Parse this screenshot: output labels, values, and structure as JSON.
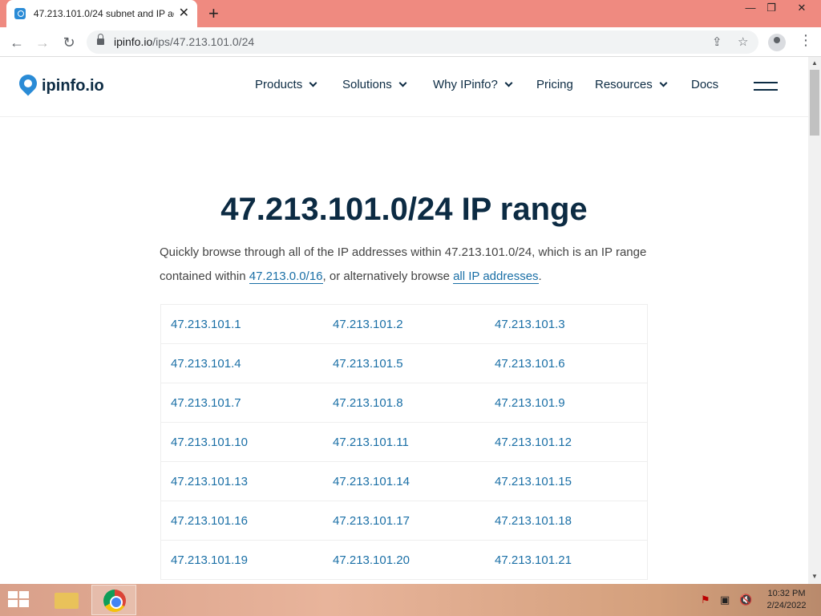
{
  "browser": {
    "tab_title": "47.213.101.0/24 subnet and IP ad",
    "url_host": "ipinfo.io",
    "url_path": "/ips/47.213.101.0/24"
  },
  "site": {
    "logo_text": "ipinfo.io",
    "nav": {
      "products": "Products",
      "solutions": "Solutions",
      "why": "Why IPinfo?",
      "pricing": "Pricing",
      "resources": "Resources",
      "docs": "Docs"
    }
  },
  "main": {
    "title": "47.213.101.0/24 IP range",
    "intro_1": "Quickly browse through all of the IP addresses within 47.213.101.0/24, which is an IP range contained within ",
    "parent_range_link": "47.213.0.0/16",
    "intro_2": ", or alternatively browse ",
    "all_ips_link": "all IP addresses",
    "intro_3": ".",
    "ip_rows": [
      [
        "47.213.101.1",
        "47.213.101.2",
        "47.213.101.3"
      ],
      [
        "47.213.101.4",
        "47.213.101.5",
        "47.213.101.6"
      ],
      [
        "47.213.101.7",
        "47.213.101.8",
        "47.213.101.9"
      ],
      [
        "47.213.101.10",
        "47.213.101.11",
        "47.213.101.12"
      ],
      [
        "47.213.101.13",
        "47.213.101.14",
        "47.213.101.15"
      ],
      [
        "47.213.101.16",
        "47.213.101.17",
        "47.213.101.18"
      ],
      [
        "47.213.101.19",
        "47.213.101.20",
        "47.213.101.21"
      ]
    ]
  },
  "taskbar": {
    "time": "10:32 PM",
    "date": "2/24/2022"
  }
}
